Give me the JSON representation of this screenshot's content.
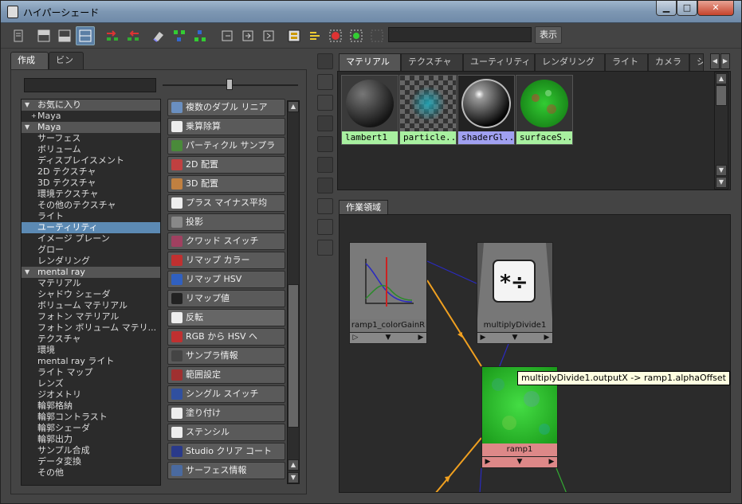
{
  "window": {
    "title": "ハイパーシェード"
  },
  "toolbar": {
    "show_label": "表示",
    "search_value": ""
  },
  "left_tabs": [
    "作成",
    "ビン"
  ],
  "left_search": {
    "value": ""
  },
  "tree": [
    {
      "label": "お気に入り",
      "type": "header"
    },
    {
      "label": "Maya",
      "type": "fav"
    },
    {
      "label": "Maya",
      "type": "header"
    },
    {
      "label": "サーフェス",
      "type": "item"
    },
    {
      "label": "ボリューム",
      "type": "item"
    },
    {
      "label": "ディスプレイスメント",
      "type": "item"
    },
    {
      "label": "2D テクスチャ",
      "type": "item"
    },
    {
      "label": "3D テクスチャ",
      "type": "item"
    },
    {
      "label": "環境テクスチャ",
      "type": "item"
    },
    {
      "label": "その他のテクスチャ",
      "type": "item"
    },
    {
      "label": "ライト",
      "type": "item"
    },
    {
      "label": "ユーティリティ",
      "type": "selected"
    },
    {
      "label": "イメージ プレーン",
      "type": "item"
    },
    {
      "label": "グロー",
      "type": "item"
    },
    {
      "label": "レンダリング",
      "type": "item"
    },
    {
      "label": "mental ray",
      "type": "header"
    },
    {
      "label": "マテリアル",
      "type": "item"
    },
    {
      "label": "シャドウ シェーダ",
      "type": "item"
    },
    {
      "label": "ボリューム マテリアル",
      "type": "item"
    },
    {
      "label": "フォトン マテリアル",
      "type": "item"
    },
    {
      "label": "フォトン ボリューム マテリ...",
      "type": "item"
    },
    {
      "label": "テクスチャ",
      "type": "item"
    },
    {
      "label": "環境",
      "type": "item"
    },
    {
      "label": "mental ray ライト",
      "type": "item"
    },
    {
      "label": "ライト マップ",
      "type": "item"
    },
    {
      "label": "レンズ",
      "type": "item"
    },
    {
      "label": "ジオメトリ",
      "type": "item"
    },
    {
      "label": "輪郭格納",
      "type": "item"
    },
    {
      "label": "輪郭コントラスト",
      "type": "item"
    },
    {
      "label": "輪郭シェーダ",
      "type": "item"
    },
    {
      "label": "輪郭出力",
      "type": "item"
    },
    {
      "label": "サンプル合成",
      "type": "item"
    },
    {
      "label": "データ変換",
      "type": "item"
    },
    {
      "label": "その他",
      "type": "item"
    }
  ],
  "nodes_list": [
    {
      "label": "複数のダブル リニア",
      "icon": "double-linear-icon",
      "color": "#6a8fc0"
    },
    {
      "label": "乗算除算",
      "icon": "multiply-divide-icon",
      "color": "#eeeeee"
    },
    {
      "label": "パーティクル サンプラ",
      "icon": "particle-sampler-icon",
      "color": "#4a8a3a"
    },
    {
      "label": "2D 配置",
      "icon": "place2d-icon",
      "color": "#c04040"
    },
    {
      "label": "3D 配置",
      "icon": "place3d-icon",
      "color": "#c08040"
    },
    {
      "label": "プラス マイナス平均",
      "icon": "plus-minus-icon",
      "color": "#eeeeee"
    },
    {
      "label": "投影",
      "icon": "projection-icon",
      "color": "#888888"
    },
    {
      "label": "クワッド スイッチ",
      "icon": "quad-switch-icon",
      "color": "#a04060"
    },
    {
      "label": "リマップ カラー",
      "icon": "remap-color-icon",
      "color": "#c03030"
    },
    {
      "label": "リマップ HSV",
      "icon": "remap-hsv-icon",
      "color": "#3060c0"
    },
    {
      "label": "リマップ値",
      "icon": "remap-value-icon",
      "color": "#222222"
    },
    {
      "label": "反転",
      "icon": "reverse-icon",
      "color": "#eeeeee"
    },
    {
      "label": "RGB から HSV へ",
      "icon": "rgb-to-hsv-icon",
      "color": "#c03030"
    },
    {
      "label": "サンプラ情報",
      "icon": "sampler-info-icon",
      "color": "#444444"
    },
    {
      "label": "範囲設定",
      "icon": "set-range-icon",
      "color": "#a03030"
    },
    {
      "label": "シングル スイッチ",
      "icon": "single-switch-icon",
      "color": "#3050a0"
    },
    {
      "label": "塗り付け",
      "icon": "smear-icon",
      "color": "#eeeeee"
    },
    {
      "label": "ステンシル",
      "icon": "stencil-icon",
      "color": "#eeeeee"
    },
    {
      "label": "Studio クリア コート",
      "icon": "clear-coat-icon",
      "color": "#2a3a8a"
    },
    {
      "label": "サーフェス情報",
      "icon": "surface-info-icon",
      "color": "#4a6aa0"
    }
  ],
  "right_tabs": [
    "マテリアル",
    "テクスチャ",
    "ユーティリティ",
    "レンダリング",
    "ライト",
    "カメラ",
    "シ"
  ],
  "swatches": [
    {
      "label": "lambert1",
      "color": "#a8f0a0"
    },
    {
      "label": "particle...",
      "color": "#a8f0a0"
    },
    {
      "label": "shaderGl...",
      "color": "#a0a0f0"
    },
    {
      "label": "surfaceS...",
      "color": "#a8f0a0"
    }
  ],
  "work_tab": "作業領域",
  "graph_nodes": {
    "colorgain": {
      "label": "ramp1_colorGainR"
    },
    "multiply": {
      "label": "multiplyDivide1"
    },
    "ramp": {
      "label": "ramp1"
    }
  },
  "tooltip": "multiplyDivide1.outputX -> ramp1.alphaOffset"
}
